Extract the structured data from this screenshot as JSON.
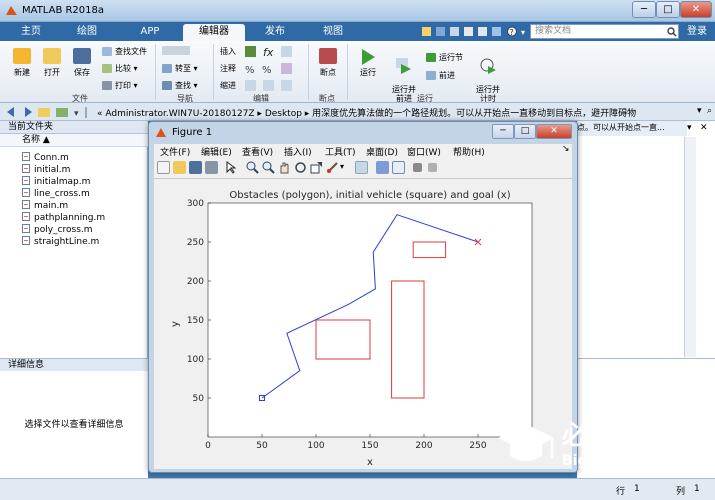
{
  "window": {
    "title": "MATLAB R2018a",
    "minimize": "─",
    "maximize": "□",
    "close": "✕"
  },
  "tabs": [
    "主页",
    "绘图",
    "APP",
    "编辑器",
    "发布",
    "视图"
  ],
  "active_tab": "编辑器",
  "search": {
    "placeholder": "搜索文档"
  },
  "login": "登录",
  "ribbon": {
    "file_big": [
      {
        "label": "新建",
        "icon": "new-icon"
      },
      {
        "label": "打开",
        "icon": "open-icon"
      },
      {
        "label": "保存",
        "icon": "save-icon"
      }
    ],
    "file_small": [
      {
        "label": "查找文件",
        "icon": "find-files-icon"
      },
      {
        "label": "比较 ▾",
        "icon": "compare-icon"
      },
      {
        "label": "打印 ▾",
        "icon": "print-icon"
      }
    ],
    "nav_small": [
      {
        "label": "",
        "icon": "back-icon"
      },
      {
        "label": "转至 ▾",
        "icon": "goto-icon"
      },
      {
        "label": "查找 ▾",
        "icon": "find-icon"
      }
    ],
    "edit_small": [
      {
        "label": "插入",
        "icon": "insert-icon"
      },
      {
        "label": "注释",
        "icon": "comment-icon"
      },
      {
        "label": "缩进",
        "icon": "indent-icon"
      }
    ],
    "breakpoint": {
      "label": "断点",
      "icon": "breakpoints-icon"
    },
    "run": {
      "label": "运行",
      "icon": "run-icon"
    },
    "run_advance": {
      "label": "运行并\n前进",
      "icon": "run-advance-icon"
    },
    "run_section": {
      "label": "运行节",
      "icon": "run-section-icon"
    },
    "advance": {
      "label": "前进",
      "icon": "advance-icon"
    },
    "run_time": {
      "label": "运行并\n计时",
      "icon": "run-time-icon"
    },
    "groups": [
      "文件",
      "导航",
      "编辑",
      "断点",
      "运行"
    ]
  },
  "address": {
    "path": "« Administrator.WIN7U-20180127Z ▸ Desktop ▸ 用深度优先算法做的一个路径规划。可以从开始点一直移动到目标点，避开障碍物"
  },
  "current_folder": {
    "title": "当前文件夹",
    "column": "名称 ▲",
    "files": [
      "Conn.m",
      "initial.m",
      "initialmap.m",
      "line_cross.m",
      "main.m",
      "pathplanning.m",
      "poly_cross.m",
      "straightLine.m"
    ]
  },
  "details": {
    "title": "详细信息",
    "text": "选择文件以查看详细信息"
  },
  "right_panel": {
    "text": "点。可以从开始点一直..."
  },
  "status": {
    "row_label": "行",
    "row": "1",
    "col_label": "列",
    "col": "1"
  },
  "figure": {
    "title": "Figure 1",
    "menu": [
      "文件(F)",
      "编辑(E)",
      "查看(V)",
      "插入(I)",
      "工具(T)",
      "桌面(D)",
      "窗口(W)",
      "帮助(H)"
    ]
  },
  "watermark": {
    "text": "必过源码",
    "url": "Biguo100.com"
  },
  "colors": {
    "accent": "#2f6aa6",
    "path": "#2d3fd6",
    "obstacle": "#e03a3a"
  },
  "chart_data": {
    "type": "line",
    "title": "Obstacles (polygon), initial vehicle (square) and goal (x)",
    "xlabel": "x",
    "ylabel": "y",
    "xlim": [
      0,
      300
    ],
    "ylim": [
      0,
      300
    ],
    "xticks": [
      0,
      50,
      100,
      150,
      200,
      250
    ],
    "yticks": [
      50,
      100,
      150,
      200,
      250,
      300
    ],
    "path": [
      [
        50,
        50
      ],
      [
        85,
        85
      ],
      [
        73,
        133
      ],
      [
        130,
        170
      ],
      [
        155,
        190
      ],
      [
        153,
        237
      ],
      [
        175,
        285
      ],
      [
        250,
        250
      ]
    ],
    "obstacles": [
      {
        "name": "rect1",
        "x": [
          100,
          150
        ],
        "y": [
          100,
          150
        ]
      },
      {
        "name": "rect2",
        "x": [
          170,
          200
        ],
        "y": [
          50,
          200
        ]
      },
      {
        "name": "rect3",
        "x": [
          190,
          220
        ],
        "y": [
          230,
          250
        ]
      }
    ],
    "start": [
      50,
      50
    ],
    "goal": [
      250,
      250
    ]
  }
}
